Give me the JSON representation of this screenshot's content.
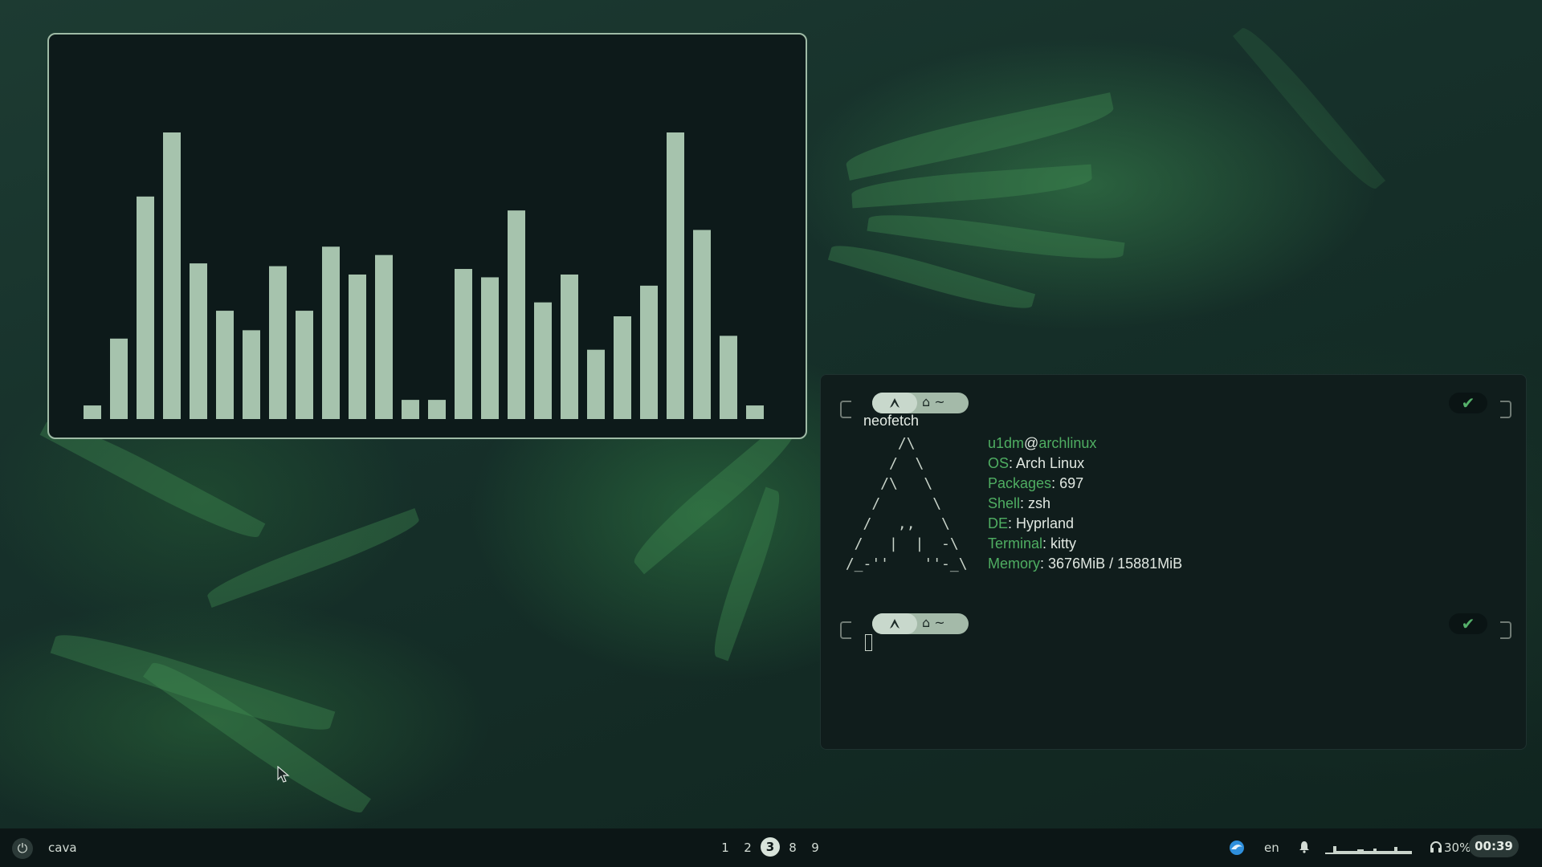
{
  "cava": {
    "bar_levels": [
      0.02,
      0.26,
      0.77,
      1.0,
      0.53,
      0.36,
      0.29,
      0.52,
      0.36,
      0.59,
      0.49,
      0.56,
      0.04,
      0.04,
      0.51,
      0.48,
      0.72,
      0.39,
      0.49,
      0.22,
      0.34,
      0.45,
      1.0,
      0.65,
      0.27,
      0.02
    ],
    "bar_color": "#a6c3ad"
  },
  "terminal": {
    "prompt_icon": "arch-icon",
    "prompt_home_icon": "home-icon",
    "prompt_dir": "~",
    "status_icon": "check-icon",
    "status_symbol": "✔",
    "command": "neofetch",
    "ascii_art": "       /\\\n      /  \\\n     /\\   \\\n    /      \\\n   /   ,,   \\\n  /   |  |  -\\\n /_-''    ''-_\\",
    "user": "u1dm",
    "at": "@",
    "host": "archlinux",
    "info": [
      {
        "key": "OS",
        "value": "Arch Linux"
      },
      {
        "key": "Packages",
        "value": "697"
      },
      {
        "key": "Shell",
        "value": "zsh"
      },
      {
        "key": "DE",
        "value": "Hyprland"
      },
      {
        "key": "Terminal",
        "value": "kitty"
      },
      {
        "key": "Memory",
        "value": "3676MiB / 15881MiB"
      }
    ],
    "accent_color": "#4fae62"
  },
  "taskbar": {
    "power_icon": "power-icon",
    "power_symbol": "⏻",
    "active_window": "cava",
    "workspaces": [
      "1",
      "2",
      "3",
      "8",
      "9"
    ],
    "active_workspace": "3",
    "language": "en",
    "bell_icon": "bell-icon",
    "headphone_icon": "headphones-icon",
    "volume": "30%",
    "clock": "00:39"
  }
}
